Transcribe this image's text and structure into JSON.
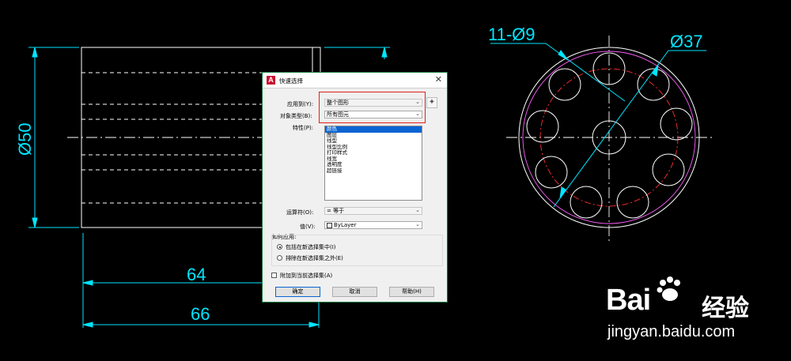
{
  "drawing": {
    "dim_height_left": "Ø50",
    "dim_width_64": "64",
    "dim_width_66": "66",
    "dim_holes": "11-Ø9",
    "dim_bolt_circle": "Ø37",
    "colors": {
      "dimension": "#00e5ff",
      "geometry": "#ffffff",
      "bolt_circle": "#ff3030",
      "outer_circle": "#ff60ff"
    }
  },
  "dialog": {
    "title": "快速选择",
    "apply_to_label": "应用到(Y):",
    "apply_to_value": "整个图形",
    "object_type_label": "对象类型(B):",
    "object_type_value": "所有图元",
    "properties_label": "特性(P):",
    "properties": [
      "颜色",
      "图层",
      "线型",
      "线型比例",
      "打印样式",
      "线宽",
      "透明度",
      "超链接"
    ],
    "selected_property": "颜色",
    "operator_label": "运算符(O):",
    "operator_value": "= 等于",
    "value_label": "值(V):",
    "value_value": "ByLayer",
    "how_to_apply_label": "如何应用:",
    "include_option": "包括在新选择集中(I)",
    "exclude_option": "排除在新选择集之外(E)",
    "append_label": "附加到当前选择集(A)",
    "ok_label": "确定",
    "cancel_label": "取消",
    "help_label": "帮助(H)"
  },
  "watermark": {
    "logo_text": "Bai",
    "brand_text": "经验",
    "url": "jingyan.baidu.com"
  }
}
